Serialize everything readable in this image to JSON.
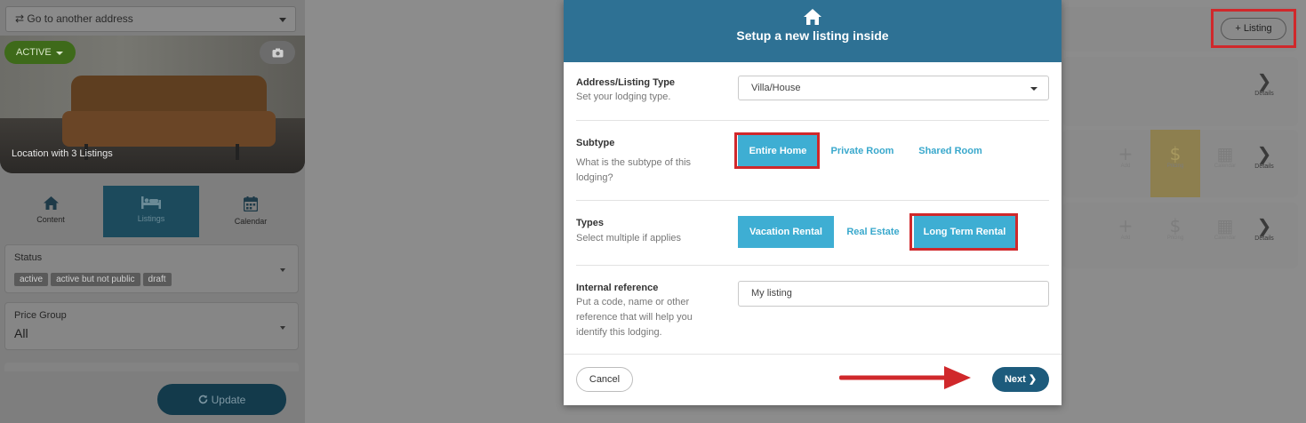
{
  "left_panel": {
    "address_select": "⇄ Go to another address",
    "status_button": "ACTIVE",
    "hero_caption": "Location with 3 Listings",
    "tabs": [
      {
        "label": "Content",
        "icon": "home-icon"
      },
      {
        "label": "Listings",
        "icon": "bed-icon",
        "selected": true
      },
      {
        "label": "Calendar",
        "icon": "calendar-icon"
      }
    ],
    "status_field": {
      "label": "Status",
      "chips": [
        "active",
        "active but not public",
        "draft"
      ]
    },
    "price_group_field": {
      "label": "Price Group",
      "value": "All"
    },
    "update_button": "Update"
  },
  "right_panel": {
    "add_listing_button": "+ Listing",
    "details_label": "Details",
    "row_icons": [
      {
        "icon": "plus-icon",
        "label": "Add"
      },
      {
        "icon": "dollar-icon",
        "label": "Pricing"
      },
      {
        "icon": "calendar-icon",
        "label": "Calendar"
      }
    ]
  },
  "modal": {
    "title": "Setup a new listing inside",
    "address_type": {
      "label": "Address/Listing Type",
      "help": "Set your lodging type.",
      "value": "Villa/House"
    },
    "subtype": {
      "label": "Subtype",
      "help": "What is the subtype of this lodging?",
      "options": [
        "Entire Home",
        "Private Room",
        "Shared Room"
      ],
      "selected": "Entire Home"
    },
    "types": {
      "label": "Types",
      "help": "Select multiple if applies",
      "options": [
        "Vacation Rental",
        "Real Estate",
        "Long Term Rental"
      ],
      "selected": [
        "Vacation Rental",
        "Long Term Rental"
      ]
    },
    "internal_reference": {
      "label": "Internal reference",
      "help": "Put a code, name or other reference that will help you identify this lodging.",
      "value": "My listing"
    },
    "cancel_button": "Cancel",
    "next_button": "Next"
  },
  "colors": {
    "modal_header": "#2e7194",
    "option_selected": "#3eaed3",
    "next_button": "#1d5b7c",
    "highlight_box": "#d0282b",
    "arrow": "#d0282b"
  }
}
